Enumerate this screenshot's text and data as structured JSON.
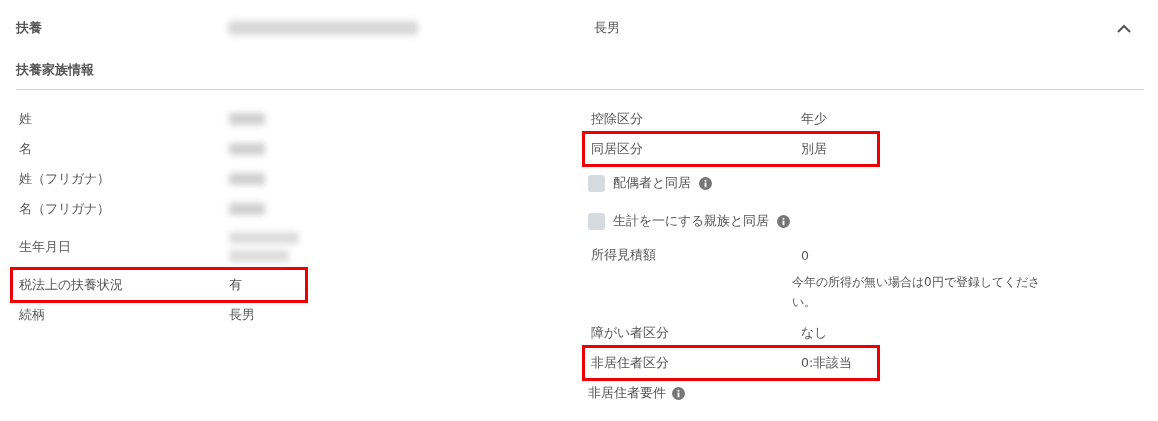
{
  "header": {
    "label": "扶養",
    "name_redacted": true,
    "relation": "長男",
    "expanded": true
  },
  "section_title": "扶養家族情報",
  "left_rows": [
    {
      "kind": "field",
      "label": "姓",
      "redacted": true,
      "highlighted": false
    },
    {
      "kind": "field",
      "label": "名",
      "redacted": true,
      "highlighted": false
    },
    {
      "kind": "field",
      "label": "姓（フリガナ）",
      "redacted": true,
      "highlighted": false
    },
    {
      "kind": "field",
      "label": "名（フリガナ）",
      "redacted": true,
      "highlighted": false
    },
    {
      "kind": "tall",
      "label": "生年月日",
      "redacted": true,
      "highlighted": false
    },
    {
      "kind": "field",
      "label": "税法上の扶養状況",
      "value": "有",
      "highlighted": true
    },
    {
      "kind": "field",
      "label": "続柄",
      "value": "長男",
      "highlighted": false
    }
  ],
  "right_rows": [
    {
      "kind": "field",
      "label": "控除区分",
      "value": "年少",
      "highlighted": false
    },
    {
      "kind": "field",
      "label": "同居区分",
      "value": "別居",
      "highlighted": true
    },
    {
      "kind": "checkbox",
      "label": "配偶者と同居",
      "checked": false,
      "info": true
    },
    {
      "kind": "checkbox",
      "label": "生計を一にする親族と同居",
      "checked": false,
      "info": true
    },
    {
      "kind": "field",
      "label": "所得見積額",
      "value": "0",
      "highlighted": false
    },
    {
      "kind": "note",
      "text": "今年の所得が無い場合は0円で登録してください。"
    },
    {
      "kind": "field",
      "label": "障がい者区分",
      "value": "なし",
      "highlighted": false
    },
    {
      "kind": "field",
      "label": "非居住者区分",
      "value": "0:非該当",
      "highlighted": true
    },
    {
      "kind": "labelinfo",
      "label": "非居住者要件",
      "info": true
    }
  ]
}
